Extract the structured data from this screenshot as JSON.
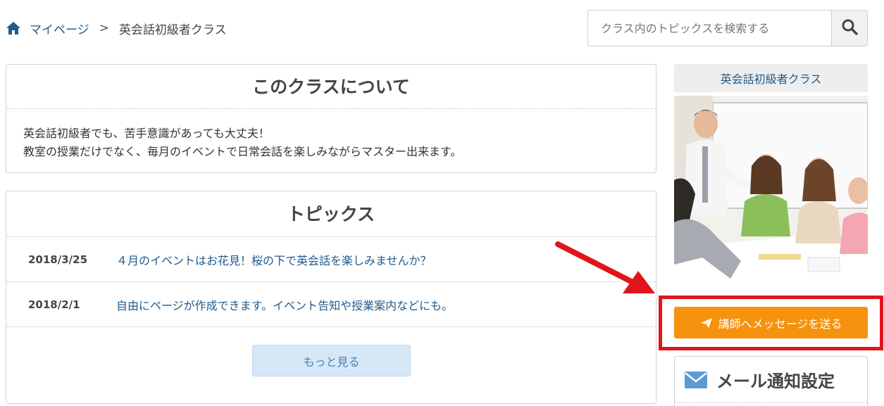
{
  "breadcrumb": {
    "home_label": "マイページ",
    "separator": ">",
    "current": "英会話初級者クラス"
  },
  "search": {
    "placeholder": "クラス内のトピックスを検索する",
    "value": ""
  },
  "about": {
    "title": "このクラスについて",
    "line1": "英会話初級者でも、苦手意識があっても大丈夫！",
    "line2": "教室の授業だけでなく、毎月のイベントで日常会話を楽しみながらマスター出来ます。"
  },
  "topics": {
    "title": "トピックス",
    "items": [
      {
        "date": "2018/3/25",
        "title": "４月のイベントはお花見！桜の下で英会話を楽しみませんか？"
      },
      {
        "date": "2018/2/1",
        "title": "自由にページが作成できます。イベント告知や授業案内などにも。"
      }
    ],
    "more_label": "もっと見る"
  },
  "sidebar": {
    "class_name": "英会話初級者クラス",
    "message_button": "講師へメッセージを送る",
    "mail_title": "メール通知設定"
  },
  "colors": {
    "link": "#1f5a8c",
    "accent_orange": "#f5920e",
    "highlight_red": "#e0151c",
    "more_button_bg": "#d6e8f8"
  }
}
